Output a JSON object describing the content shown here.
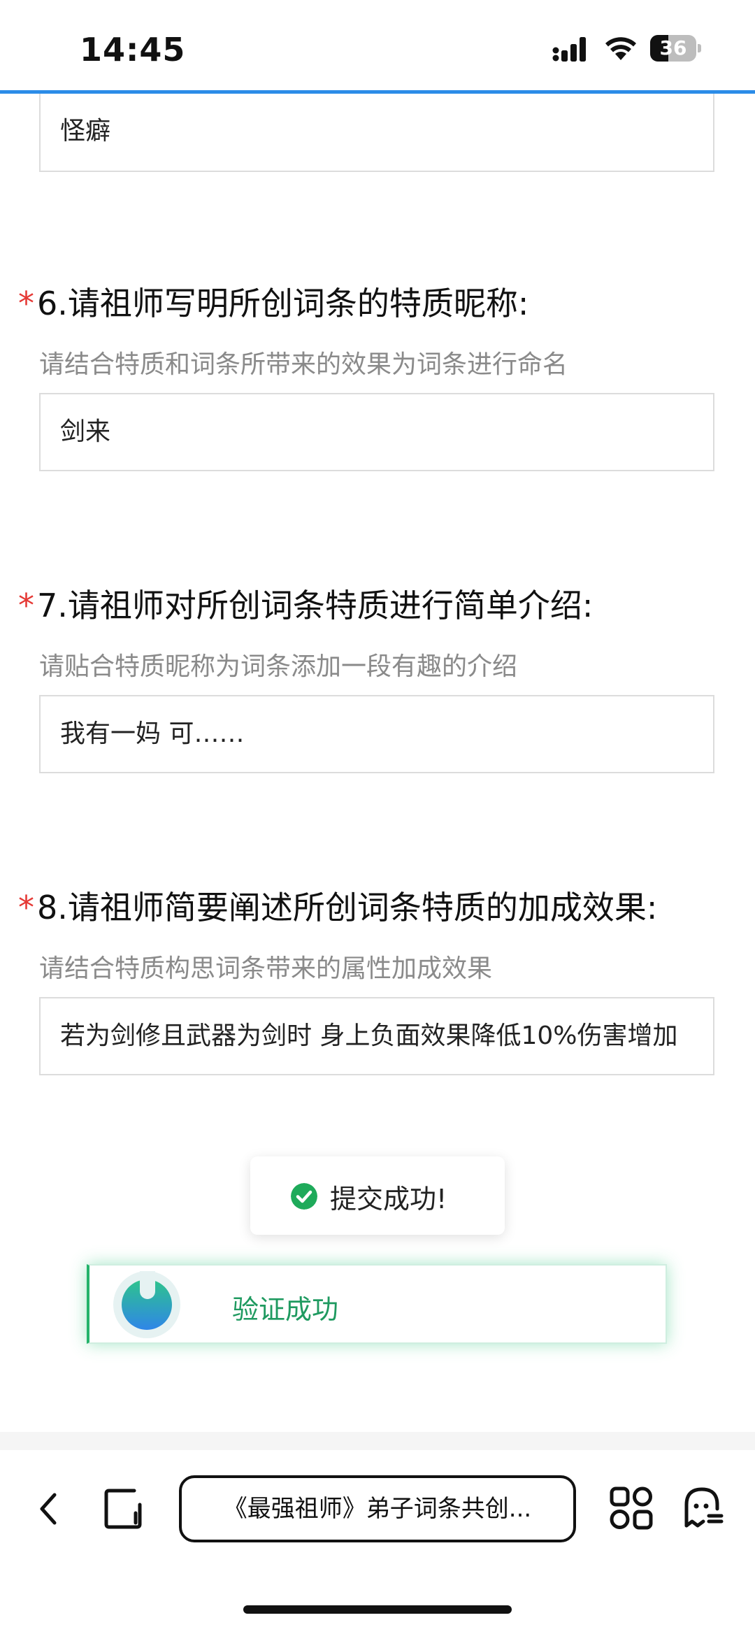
{
  "status_bar": {
    "time": "14:45",
    "battery": "36"
  },
  "form": {
    "prev_answer": "怪癖",
    "questions": [
      {
        "required_mark": "*",
        "title": "6.请祖师写明所创词条的特质昵称:",
        "hint": "请结合特质和词条所带来的效果为词条进行命名",
        "answer": "剑来"
      },
      {
        "required_mark": "*",
        "title": "7.请祖师对所创词条特质进行简单介绍:",
        "hint": "请贴合特质昵称为词条添加一段有趣的介绍",
        "answer": "我有一妈 可……"
      },
      {
        "required_mark": "*",
        "title": "8.请祖师简要阐述所创词条特质的加成效果:",
        "hint": "请结合特质构思词条带来的属性加成效果",
        "answer": "若为剑修且武器为剑时 身上负面效果降低10%伤害增加"
      }
    ]
  },
  "toast": {
    "text": "提交成功!",
    "icon": "check-circle-icon",
    "color": "#1eaa5a"
  },
  "captcha": {
    "text": "验证成功",
    "color": "#1f9a60"
  },
  "browser": {
    "url_title": "《最强祖师》弟子词条共创...",
    "icons": [
      "back-chevron-icon",
      "tabs-icon",
      "apps-grid-icon",
      "ghost-menu-icon"
    ]
  }
}
